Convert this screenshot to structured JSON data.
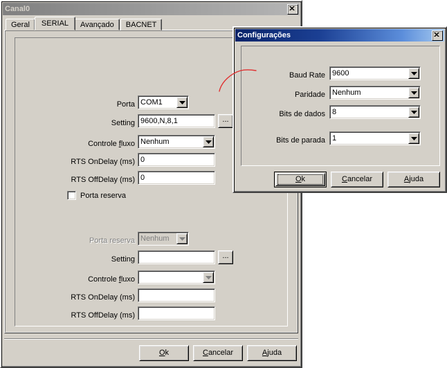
{
  "main_window": {
    "title": "Canal0",
    "close_icon": "close-icon",
    "tabs": [
      {
        "label": "Geral",
        "selected": false
      },
      {
        "label": "SERIAL",
        "selected": true
      },
      {
        "label": "Avançado",
        "selected": false
      },
      {
        "label": "BACNET",
        "selected": false
      }
    ],
    "primary_group": {
      "porta": {
        "label": "Porta",
        "value": "COM1"
      },
      "setting": {
        "label": "Setting",
        "value": "9600,N,8,1",
        "browse_button": "..."
      },
      "controle_fluxo": {
        "label": "Controle fluxo",
        "label_mnemonic": "f",
        "value": "Nenhum"
      },
      "rts_ondelay": {
        "label": "RTS OnDelay (ms)",
        "value": "0"
      },
      "rts_offdelay": {
        "label": "RTS OffDelay (ms)",
        "value": "0"
      }
    },
    "reserve_group": {
      "enable": {
        "label": "Porta reserva",
        "checked": false
      },
      "porta_reserva": {
        "label": "Porta reserva",
        "value": "Nenhum"
      },
      "setting": {
        "label": "Setting",
        "value": "",
        "browse_button": "..."
      },
      "controle_fluxo": {
        "label": "Controle fluxo",
        "label_mnemonic": "f",
        "value": ""
      },
      "rts_ondelay": {
        "label": "RTS OnDelay (ms)",
        "value": ""
      },
      "rts_offdelay": {
        "label": "RTS OffDelay (ms)",
        "value": ""
      }
    },
    "buttons": {
      "ok": {
        "label": "Ok",
        "mnemonic": "O"
      },
      "cancel": {
        "label": "Cancelar",
        "mnemonic": "C"
      },
      "help": {
        "label": "Ajuda",
        "mnemonic": "A"
      }
    }
  },
  "modal_dialog": {
    "title": "Configurações",
    "close_icon": "close-icon",
    "fields": {
      "baud_rate": {
        "label": "Baud Rate",
        "value": "9600"
      },
      "paridade": {
        "label": "Paridade",
        "value": "Nenhum"
      },
      "bits_de_dados": {
        "label": "Bits de dados",
        "value": "8"
      },
      "bits_de_parada": {
        "label": "Bits de parada",
        "value": "1"
      }
    },
    "buttons": {
      "ok": {
        "label": "Ok",
        "mnemonic": "O",
        "is_default": true
      },
      "cancel": {
        "label": "Cancelar",
        "mnemonic": "C"
      },
      "help": {
        "label": "Ajuda",
        "mnemonic": "A"
      }
    }
  },
  "annotation": {
    "type": "arrow-curve",
    "color": "#e03030",
    "from": "setting-browse-button",
    "to": "configuracoes-dialog"
  }
}
